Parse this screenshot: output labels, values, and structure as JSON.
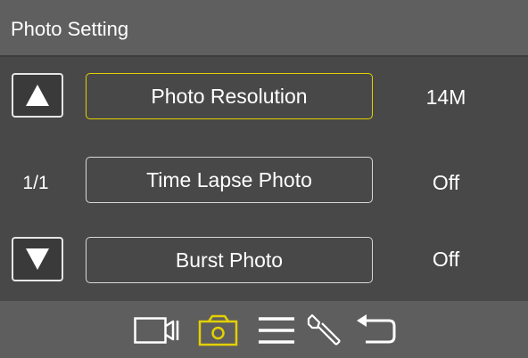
{
  "header": {
    "title": "Photo Setting"
  },
  "pager": {
    "indicator": "1/1",
    "up_icon": "arrow-up-icon",
    "down_icon": "arrow-down-icon"
  },
  "menu": {
    "items": [
      {
        "label": "Photo Resolution",
        "value": "14M",
        "selected": true
      },
      {
        "label": "Time Lapse Photo",
        "value": "Off",
        "selected": false
      },
      {
        "label": "Burst Photo",
        "value": "Off",
        "selected": false
      }
    ]
  },
  "toolbar": {
    "icons": [
      "video-camera-icon",
      "photo-camera-icon",
      "menu-icon",
      "wrench-icon",
      "return-icon"
    ],
    "active": "photo-camera-icon"
  },
  "colors": {
    "accent": "#e4d000",
    "header_bg": "#5f5f5f",
    "body_bg": "#484848",
    "border": "#d8d8d8"
  }
}
